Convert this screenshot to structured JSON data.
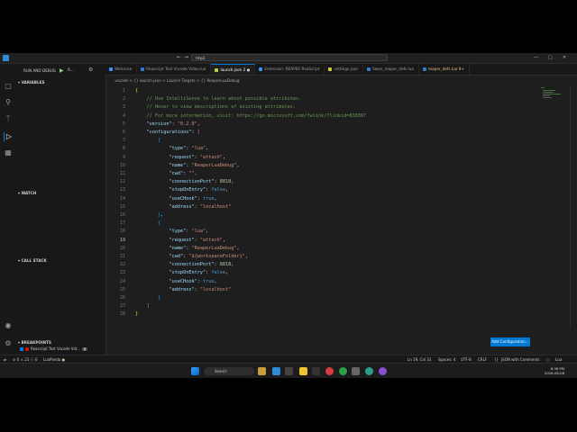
{
  "window": {
    "search_text": "tmp2"
  },
  "activity_bar": {
    "icons": [
      "explorer-icon",
      "search-icon",
      "source-control-icon",
      "run-debug-icon",
      "extensions-icon",
      "account-icon",
      "manage-icon"
    ]
  },
  "sidebar": {
    "title": "RUN AND DEBUG",
    "config_name": "R...",
    "sections": {
      "variables": "VARIABLES",
      "watch": "WATCH",
      "call_stack": "CALL STACK",
      "breakpoints": "BREAKPOINTS"
    },
    "breakpoint_item": {
      "label": "Reascript Test Vscode Vid...",
      "count": "6"
    }
  },
  "tabs": [
    {
      "label": "Welcome",
      "color": "#3794ff"
    },
    {
      "label": "Reascript Test Vscode Video.lua",
      "color": "#2f7dd1"
    },
    {
      "label": "launch.json 2",
      "color": "#cbcb41",
      "active": true
    },
    {
      "label": "Extension: REAPER ReaScript",
      "color": "#3794ff"
    },
    {
      "label": "settings.json",
      "color": "#cbcb41"
    },
    {
      "label": "Swan_reaper_defs.lua",
      "color": "#2f7dd1"
    },
    {
      "label": "reaper_defs.lua 9+",
      "color": "#2f7dd1",
      "modified": true
    }
  ],
  "breadcrumb": ".vscode > {} launch.json > Launch Targets > {} ReaperLuaDebug",
  "editor": {
    "line_numbers": [
      "1",
      "2",
      "3",
      "4",
      "5",
      "6",
      "7",
      "8",
      "9",
      "10",
      "11",
      "12",
      "13",
      "14",
      "15",
      "16",
      "17",
      "18",
      "19",
      "20",
      "21",
      "22",
      "23",
      "24",
      "25",
      "26",
      "27",
      "28"
    ],
    "current_line": "19",
    "comments": [
      "// Use IntelliSense to learn about possible attributes.",
      "// Hover to view descriptions of existing attributes.",
      "// For more information, visit: https://go.microsoft.com/fwlink/?linkid=830387"
    ],
    "version_key": "\"version\"",
    "version_val": "\"0.2.0\"",
    "configurations_key": "\"configurations\"",
    "config1": {
      "type": "\"lua\"",
      "request": "\"attach\"",
      "name": "\"ReaperLuaDebug\"",
      "cwd": "\"\"",
      "connectionPort": "8818",
      "stopOnEntry": "false",
      "useCHook": "true",
      "address": "\"localhost\""
    },
    "config2": {
      "type": "\"lua\"",
      "request": "\"attach\"",
      "name": "\"ReaperLuaDebug\"",
      "cwd": "\"${workspaceFolder}\"",
      "connectionPort": "8818",
      "stopOnEntry": "false",
      "useCHook": "true",
      "address": "\"localhost\""
    }
  },
  "add_configuration_label": "Add Configuration...",
  "status_bar": {
    "errors": "0",
    "warnings": "21",
    "info": "0",
    "lua_panda": "LuaPanda",
    "position": "Ln 19, Col 33",
    "spaces": "Spaces: 4",
    "encoding": "UTF-8",
    "eol": "CRLF",
    "language": "JSON with Comments",
    "lang2": "Lua"
  },
  "taskbar": {
    "search_label": "Search",
    "time": "8:36 PM",
    "date": "2026-08-08"
  }
}
